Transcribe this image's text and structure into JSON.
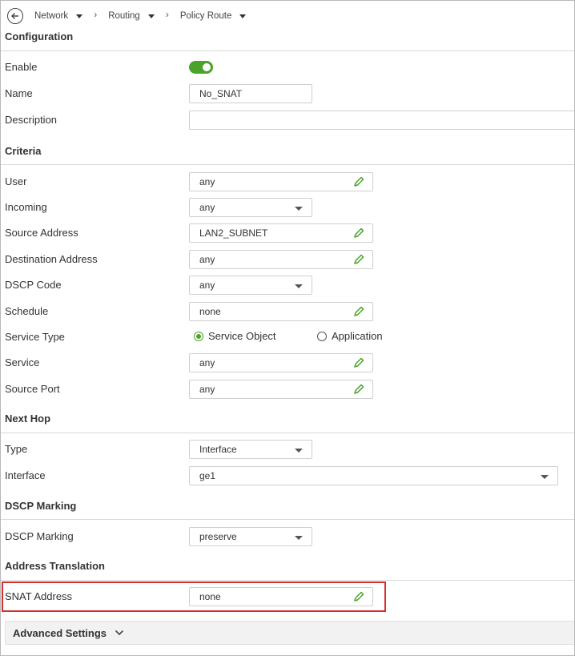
{
  "breadcrumb": {
    "items": [
      "Network",
      "Routing",
      "Policy Route"
    ],
    "separator": "›"
  },
  "configuration": {
    "title": "Configuration",
    "enable_label": "Enable",
    "enable_value": true,
    "name_label": "Name",
    "name_value": "No_SNAT",
    "description_label": "Description",
    "description_value": ""
  },
  "criteria": {
    "title": "Criteria",
    "user_label": "User",
    "user_value": "any",
    "incoming_label": "Incoming",
    "incoming_value": "any",
    "source_address_label": "Source Address",
    "source_address_value": "LAN2_SUBNET",
    "destination_address_label": "Destination Address",
    "destination_address_value": "any",
    "dscp_code_label": "DSCP Code",
    "dscp_code_value": "any",
    "schedule_label": "Schedule",
    "schedule_value": "none",
    "service_type_label": "Service Type",
    "service_type_options": [
      "Service Object",
      "Application"
    ],
    "service_type_selected": "Service Object",
    "service_label": "Service",
    "service_value": "any",
    "source_port_label": "Source Port",
    "source_port_value": "any"
  },
  "next_hop": {
    "title": "Next Hop",
    "type_label": "Type",
    "type_value": "Interface",
    "interface_label": "Interface",
    "interface_value": "ge1"
  },
  "dscp_marking": {
    "title": "DSCP Marking",
    "label": "DSCP Marking",
    "value": "preserve"
  },
  "address_translation": {
    "title": "Address Translation",
    "snat_label": "SNAT Address",
    "snat_value": "none"
  },
  "advanced": {
    "label": "Advanced Settings"
  },
  "colors": {
    "accent": "#4aa32a",
    "highlight": "#d32f2f"
  },
  "icons": {
    "back": "back-circle-icon",
    "edit": "pencil-icon",
    "dropdown": "caret-down-icon",
    "expand": "chevron-down-icon"
  }
}
